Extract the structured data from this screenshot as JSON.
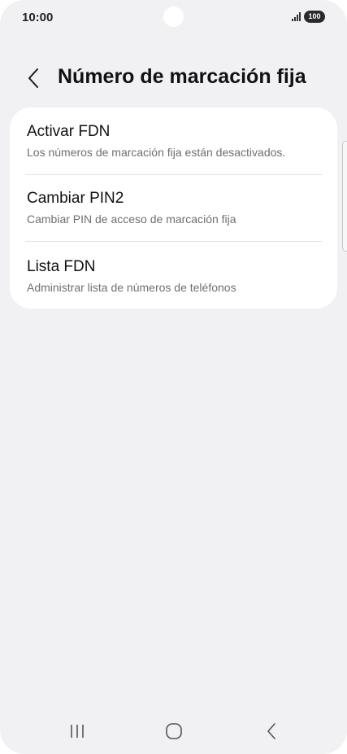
{
  "status_bar": {
    "time": "10:00",
    "battery": "100"
  },
  "header": {
    "title": "Número de marcación fija"
  },
  "settings": {
    "items": [
      {
        "title": "Activar FDN",
        "subtitle": "Los números de marcación fija están desactivados."
      },
      {
        "title": "Cambiar PIN2",
        "subtitle": "Cambiar PIN de acceso de marcación fija"
      },
      {
        "title": "Lista FDN",
        "subtitle": "Administrar lista de números de teléfonos"
      }
    ]
  },
  "icons": {
    "back": "chevron-left-icon",
    "signal": "signal-icon",
    "recents": "recents-icon",
    "home": "home-icon",
    "nav_back": "back-icon"
  }
}
